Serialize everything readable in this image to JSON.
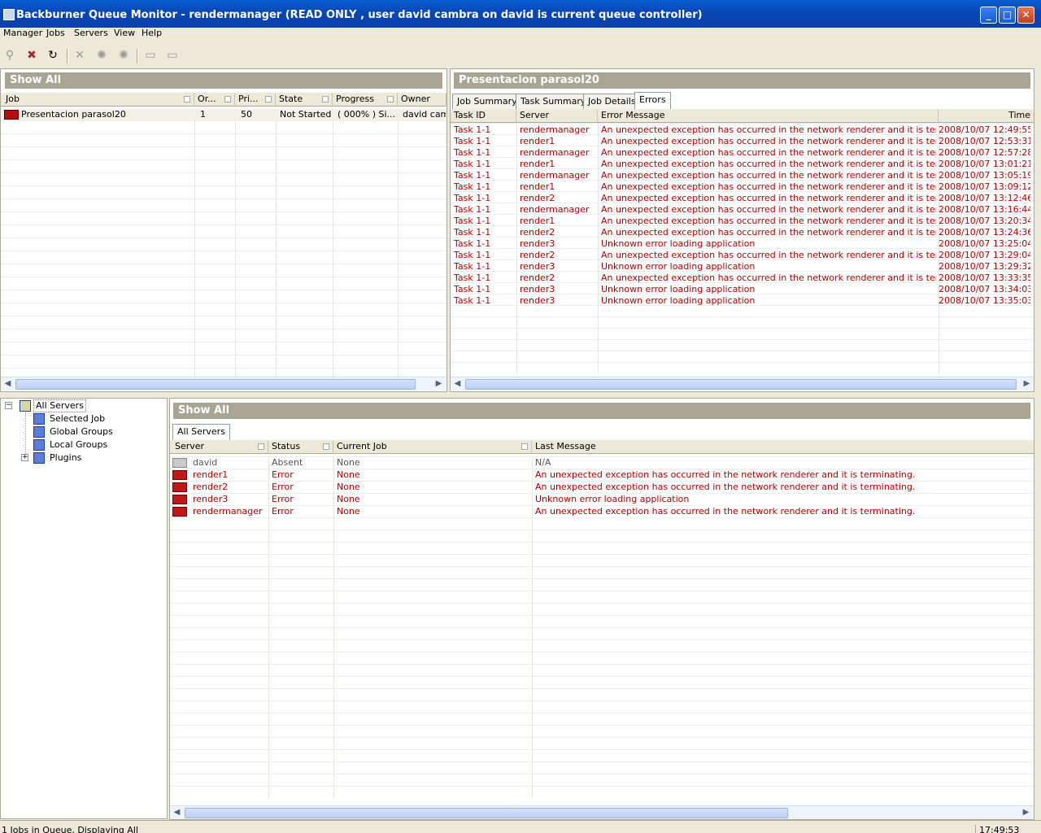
{
  "window": {
    "title": "Backburner Queue Monitor - rendermanager (READ ONLY , user david cambra on david is current queue controller)"
  },
  "menu": [
    "Manager",
    "Jobs",
    "Servers",
    "View",
    "Help"
  ],
  "toolbar": {
    "icons": [
      "job-icon",
      "remove-job-icon",
      "refresh-icon",
      "delete-icon",
      "activate-icon",
      "deactivate-icon",
      "server-icon",
      "server2-icon"
    ]
  },
  "jobs_panel": {
    "band": "Show All",
    "headers": [
      "Job",
      "Or...",
      "Pri...",
      "State",
      "Progress",
      "Owner"
    ],
    "rows": [
      {
        "job": "Presentacion parasol20",
        "order": "1",
        "priority": "50",
        "state": "Not Started",
        "progress": "( 000% ) Si...",
        "owner": "david camb"
      }
    ]
  },
  "details_panel": {
    "band": "Presentacion parasol20",
    "tabs": [
      "Job Summary",
      "Task Summary",
      "Job Details",
      "Errors"
    ],
    "active_tab": "Errors",
    "headers": [
      "Task ID",
      "Server",
      "Error Message",
      "Time"
    ],
    "rows": [
      {
        "task": "Task 1-1",
        "server": "rendermanager",
        "msg": "An unexpected exception has occurred in the network renderer and it is terminating.",
        "time": "2008/10/07 12:49:55"
      },
      {
        "task": "Task 1-1",
        "server": "render1",
        "msg": "An unexpected exception has occurred in the network renderer and it is terminating.",
        "time": "2008/10/07 12:53:31"
      },
      {
        "task": "Task 1-1",
        "server": "rendermanager",
        "msg": "An unexpected exception has occurred in the network renderer and it is terminating.",
        "time": "2008/10/07 12:57:28"
      },
      {
        "task": "Task 1-1",
        "server": "render1",
        "msg": "An unexpected exception has occurred in the network renderer and it is terminating.",
        "time": "2008/10/07 13:01:21"
      },
      {
        "task": "Task 1-1",
        "server": "rendermanager",
        "msg": "An unexpected exception has occurred in the network renderer and it is terminating.",
        "time": "2008/10/07 13:05:19"
      },
      {
        "task": "Task 1-1",
        "server": "render1",
        "msg": "An unexpected exception has occurred in the network renderer and it is terminating.",
        "time": "2008/10/07 13:09:12"
      },
      {
        "task": "Task 1-1",
        "server": "render2",
        "msg": "An unexpected exception has occurred in the network renderer and it is terminating.",
        "time": "2008/10/07 13:12:46"
      },
      {
        "task": "Task 1-1",
        "server": "rendermanager",
        "msg": "An unexpected exception has occurred in the network renderer and it is terminating.",
        "time": "2008/10/07 13:16:44"
      },
      {
        "task": "Task 1-1",
        "server": "render1",
        "msg": "An unexpected exception has occurred in the network renderer and it is terminating.",
        "time": "2008/10/07 13:20:34"
      },
      {
        "task": "Task 1-1",
        "server": "render2",
        "msg": "An unexpected exception has occurred in the network renderer and it is terminating.",
        "time": "2008/10/07 13:24:36"
      },
      {
        "task": "Task 1-1",
        "server": "render3",
        "msg": "Unknown error loading application",
        "time": "2008/10/07 13:25:04"
      },
      {
        "task": "Task 1-1",
        "server": "render2",
        "msg": "An unexpected exception has occurred in the network renderer and it is terminating.",
        "time": "2008/10/07 13:29:04"
      },
      {
        "task": "Task 1-1",
        "server": "render3",
        "msg": "Unknown error loading application",
        "time": "2008/10/07 13:29:32"
      },
      {
        "task": "Task 1-1",
        "server": "render2",
        "msg": "An unexpected exception has occurred in the network renderer and it is terminating.",
        "time": "2008/10/07 13:33:35"
      },
      {
        "task": "Task 1-1",
        "server": "render3",
        "msg": "Unknown error loading application",
        "time": "2008/10/07 13:34:03"
      },
      {
        "task": "Task 1-1",
        "server": "render3",
        "msg": "Unknown error loading application",
        "time": "2008/10/07 13:35:03"
      }
    ]
  },
  "tree": [
    {
      "label": "All Servers",
      "expander": "−",
      "icon": "all-servers-icon"
    },
    {
      "label": "Selected Job",
      "icon": "server-group-icon"
    },
    {
      "label": "Global Groups",
      "icon": "server-group-icon"
    },
    {
      "label": "Local Groups",
      "icon": "server-group-icon"
    },
    {
      "label": "Plugins",
      "expander": "+",
      "icon": "plugins-icon"
    }
  ],
  "servers_panel": {
    "band": "Show All",
    "tabs": [
      "All Servers"
    ],
    "headers": [
      "Server",
      "Status",
      "Current Job",
      "Last Message"
    ],
    "rows": [
      {
        "server": "david",
        "status": "Absent",
        "job": "None",
        "msg": "N/A",
        "error": false
      },
      {
        "server": "render1",
        "status": "Error",
        "job": "None",
        "msg": "An unexpected exception has occurred in the network renderer and it is terminating.",
        "error": true
      },
      {
        "server": "render2",
        "status": "Error",
        "job": "None",
        "msg": "An unexpected exception has occurred in the network renderer and it is terminating.",
        "error": true
      },
      {
        "server": "render3",
        "status": "Error",
        "job": "None",
        "msg": "Unknown error loading application",
        "error": true
      },
      {
        "server": "rendermanager",
        "status": "Error",
        "job": "None",
        "msg": "An unexpected exception has occurred in the network renderer and it is terminating.",
        "error": true
      }
    ]
  },
  "status": {
    "left": "1 Jobs in Queue, Displaying All",
    "clock": "17:49:53"
  },
  "colors": {
    "error": "#b50000",
    "band": "#a8a594",
    "title": "#0a5fd6"
  }
}
